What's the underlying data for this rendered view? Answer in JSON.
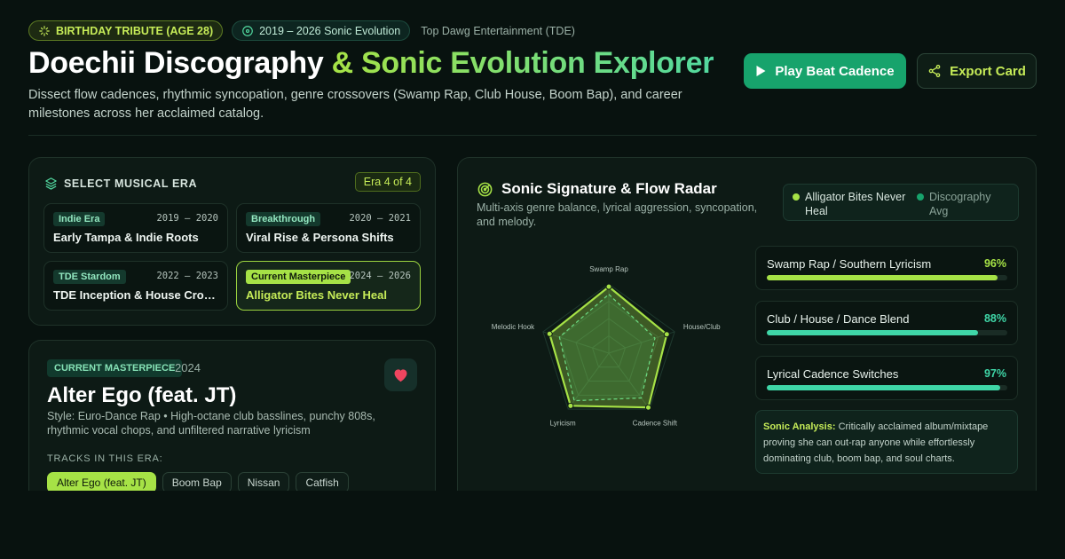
{
  "header": {
    "badge_birthday": "BIRTHDAY TRIBUTE (AGE 28)",
    "badge_years": "2019 – 2026 Sonic Evolution",
    "label_label": "Top Dawg Entertainment (TDE)",
    "title_part1": "Doechii Discography",
    "title_part2": "& Sonic Evolution Explorer",
    "subtitle": "Dissect flow cadences, rhythmic syncopation, genre crossovers (Swamp Rap, Club House, Boom Bap), and career milestones across her acclaimed catalog.",
    "play_label": "Play Beat Cadence",
    "export_label": "Export Card"
  },
  "era_selector": {
    "heading": "SELECT MUSICAL ERA",
    "count": "Era 4 of 4",
    "eras": [
      {
        "tag": "Indie Era",
        "years": "2019 – 2020",
        "name": "Early Tampa & Indie Roots",
        "active": false
      },
      {
        "tag": "Breakthrough",
        "years": "2020 – 2021",
        "name": "Viral Rise & Persona Shifts",
        "active": false
      },
      {
        "tag": "TDE Stardom",
        "years": "2022 – 2023",
        "name": "TDE Inception & House Crossover",
        "active": false
      },
      {
        "tag": "Current Masterpiece",
        "years": "2024 – 2026",
        "name": "Alligator Bites Never Heal",
        "active": true
      }
    ]
  },
  "album": {
    "tag": "CURRENT MASTERPIECE",
    "year": "2024",
    "title": "Alter Ego (feat. JT)",
    "style": "Style: Euro-Dance Rap • High-octane club basslines, punchy 808s, rhythmic vocal chops, and unfiltered narrative lyricism",
    "tracks_label": "TRACKS IN THIS ERA:",
    "tracks": [
      "Alter Ego (feat. JT)",
      "Boom Bap",
      "Nissan",
      "Catfish"
    ],
    "active_track": 0
  },
  "radar": {
    "title": "Sonic Signature & Flow Radar",
    "description": "Multi-axis genre balance, lyrical aggression, syncopation, and melody.",
    "legend": [
      {
        "name": "Alligator Bites Never Heal",
        "color": "#a6e246"
      },
      {
        "name": "Discography Avg",
        "color": "#17a36c"
      }
    ],
    "axes": [
      "Swamp Rap",
      "House/Club",
      "Cadence Shift",
      "Lyricism",
      "Melodic Hook"
    ],
    "series_current": [
      96,
      88,
      97,
      94,
      90
    ],
    "series_avg": [
      85,
      70,
      80,
      85,
      75
    ],
    "max": 100
  },
  "metrics": [
    {
      "name": "Swamp Rap / Southern Lyricism",
      "value": 96,
      "display": "96%",
      "color": "#a6e246"
    },
    {
      "name": "Club / House / Dance Blend",
      "value": 88,
      "display": "88%",
      "color": "#3fd6a7"
    },
    {
      "name": "Lyrical Cadence Switches",
      "value": 97,
      "display": "97%",
      "color": "#3fd6a7"
    }
  ],
  "analysis": {
    "label": "Sonic Analysis:",
    "text": "Critically acclaimed album/mixtape proving she can out-rap anyone while effortlessly dominating club, boom bap, and soul charts."
  }
}
